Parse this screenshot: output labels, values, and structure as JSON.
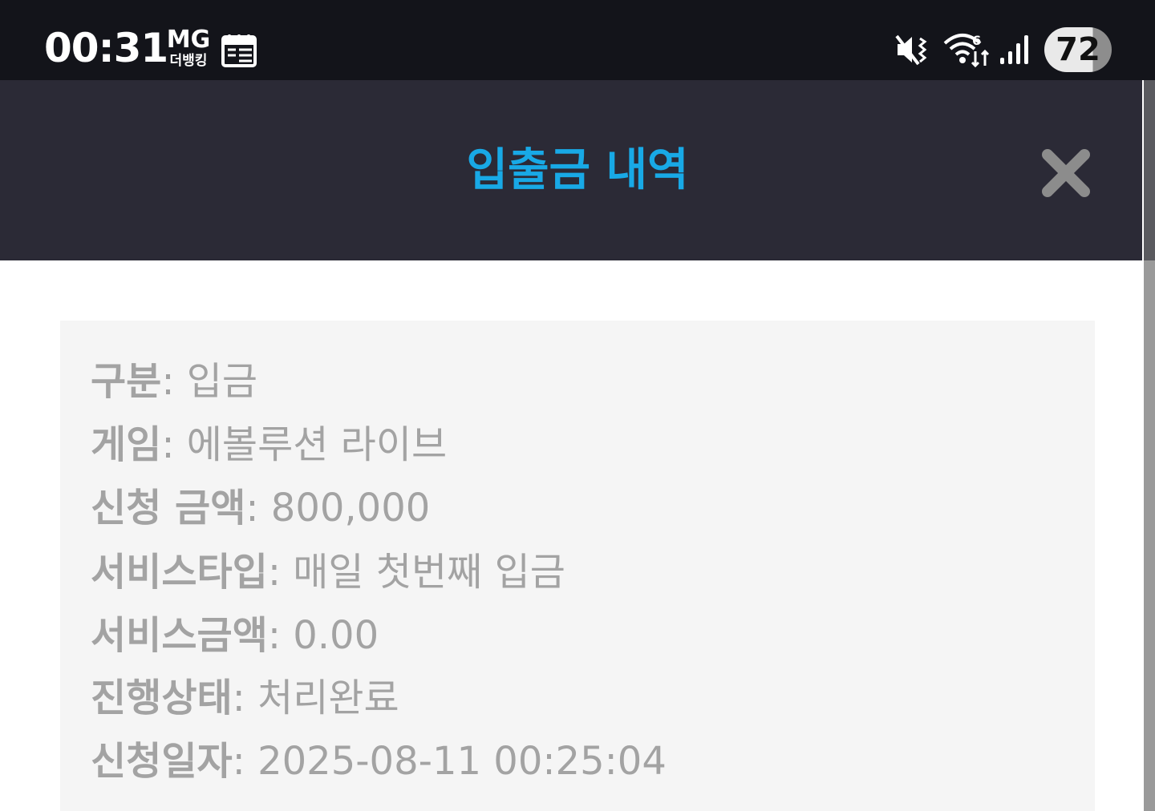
{
  "status_bar": {
    "time": "00:31",
    "app_badge_main": "MG",
    "app_badge_sub": "더뱅킹",
    "battery": "72"
  },
  "modal": {
    "title": "입출금 내역",
    "close_icon": "close-icon"
  },
  "details": [
    {
      "label": "구분",
      "value": "입금"
    },
    {
      "label": "게임",
      "value": "에볼루션 라이브"
    },
    {
      "label": "신청 금액",
      "value": "800,000"
    },
    {
      "label": "서비스타입",
      "value": "매일 첫번째 입금"
    },
    {
      "label": "서비스금액",
      "value": "0.00"
    },
    {
      "label": "진행상태",
      "value": "처리완료"
    },
    {
      "label": "신청일자",
      "value": "2025-08-11 00:25:04"
    }
  ],
  "separator": ": ",
  "colors": {
    "status_bar_bg": "#13141a",
    "header_bg": "#2b2a36",
    "title_accent": "#18a9e6",
    "card_bg": "#f5f5f5",
    "text_gray": "#a3a3a3",
    "close_icon": "#8c8c8c"
  }
}
